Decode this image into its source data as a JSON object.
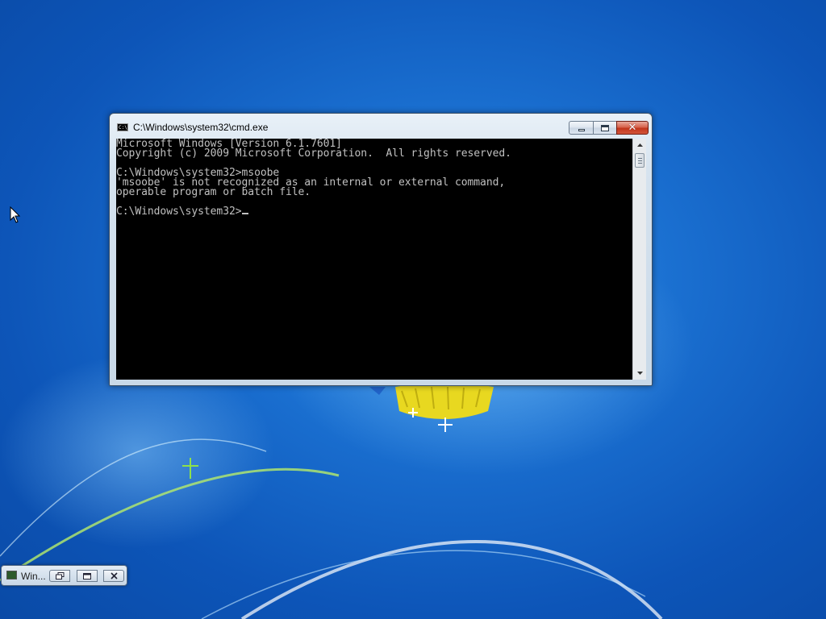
{
  "window": {
    "title": "C:\\Windows\\system32\\cmd.exe",
    "icon": "cmd-icon",
    "icon_label": "C:\\"
  },
  "console": {
    "lines": [
      "Microsoft Windows [Version 6.1.7601]",
      "Copyright (c) 2009 Microsoft Corporation.  All rights reserved.",
      "",
      "C:\\Windows\\system32>msoobe",
      "'msoobe' is not recognized as an internal or external command,",
      "operable program or batch file.",
      "",
      "C:\\Windows\\system32>"
    ]
  },
  "minimized_window": {
    "title": "Win..."
  },
  "colors": {
    "console_bg": "#000000",
    "console_text": "#c0c0c0",
    "close_button": "#c2361d"
  }
}
